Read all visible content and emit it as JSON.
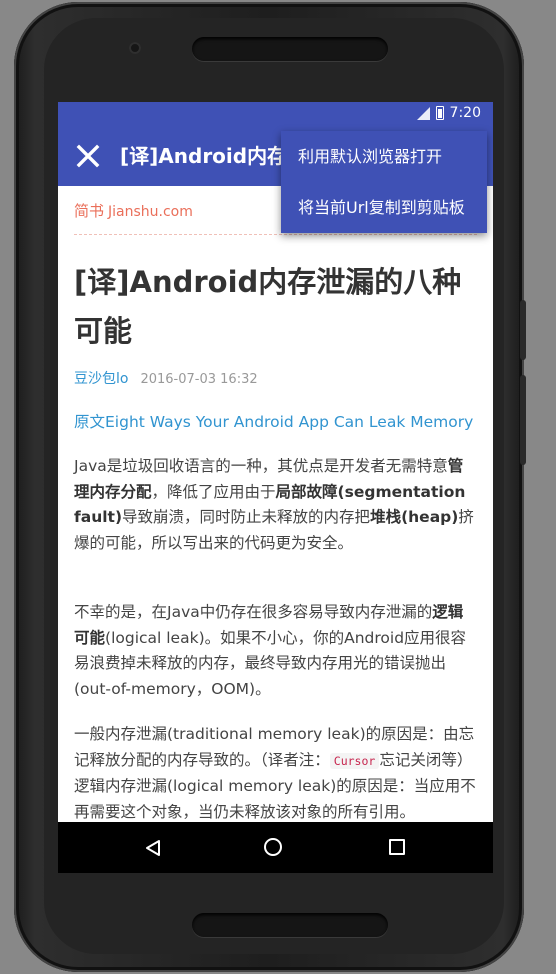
{
  "status_bar": {
    "time": "7:20"
  },
  "app_bar": {
    "title": "[译]Android内存泄漏的八种可能"
  },
  "menu": {
    "items": [
      {
        "label": "利用默认浏览器打开"
      },
      {
        "label": "将当前Url复制到剪贴板"
      }
    ]
  },
  "article": {
    "site_name": "简书",
    "site_domain": "Jianshu.com",
    "title": "[译]Android内存泄漏的八种可能",
    "author": "豆沙包lo",
    "date": "2016-07-03 16:32",
    "original_link": "原文Eight Ways Your Android App Can Leak Memory",
    "p1": {
      "t1": "Java是垃圾回收语言的一种，其优点是开发者无需特意",
      "b1": "管理内存分配",
      "t2": "，降低了应用由于",
      "b2": "局部故障(segmentation fault)",
      "t3": "导致崩溃，同时防止未释放的内存把",
      "b3": "堆栈(heap)",
      "t4": "挤爆的可能，所以写出来的代码更为安全。"
    },
    "p2": {
      "t1": "不幸的是，在Java中仍存在很多容易导致内存泄漏的",
      "b1": "逻辑可能",
      "t2": "(logical leak)。如果不小心，你的Android应用很容易浪费掉未释放的内存，最终导致内存用光的错误抛出(out-of-memory，OOM)。"
    },
    "p3": {
      "t1": "一般内存泄漏(traditional memory leak)的原因是：由忘记释放分配的内存导致的。（译者注：",
      "code": "Cursor",
      "t2": "忘记关闭等）",
      "t3": "逻辑内存泄漏(logical memory leak)的原因是：当应用不再需要这个对象，当仍未释放该对象的所有引用。"
    }
  },
  "colors": {
    "primary": "#3f51b5",
    "site": "#ea6f5a",
    "link": "#3194d0"
  }
}
